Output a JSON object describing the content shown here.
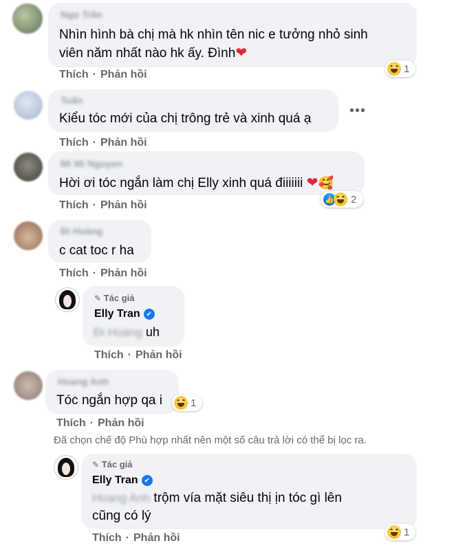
{
  "comments": [
    {
      "name": "Ngọ Trần",
      "line1": "Nhìn hình bà chị mà hk nhìn tên nic e tưởng nhỏ sinh",
      "line2": "viên năm nhất nào hk ấy. Đình",
      "reaction_count": "1"
    },
    {
      "name": "Tuấn",
      "text": "Kiểu tóc mới của chị trông trẻ và xinh quá ạ"
    },
    {
      "name": "Mi Mi Nguyen",
      "text": "Hời ơi tóc ngắn làm chị Elly xinh quá điiiiiii",
      "reaction_count": "2"
    },
    {
      "name": "Đi Hoàng",
      "text": "c cat toc r ha"
    },
    {
      "name": "Hoang Anh",
      "text": "Tóc ngắn hợp qa i",
      "reaction_count": "1"
    }
  ],
  "replies": [
    {
      "tag": "Tác giả",
      "author": "Elly Tran",
      "mention": "Đi Hoàng",
      "text": "uh"
    },
    {
      "tag": "Tác giả",
      "author": "Elly Tran",
      "mention": "Hoang Anh",
      "line1": "trộm vía mặt siêu thị ịn tóc gì lên",
      "line2": "cũng có lý",
      "reaction_count": "1"
    }
  ],
  "actions": {
    "like": "Thích",
    "reply": "Phản hồi"
  },
  "notice": "Đã chọn chế độ Phù hợp nhất nên một số câu trả lời có thể bị lọc ra.",
  "icons": {
    "verified": "verified-check-icon",
    "more": "more-options-icon",
    "author": "pencil-icon",
    "haha": "haha-reaction-icon",
    "like": "like-reaction-icon",
    "heart": "heart-emoji",
    "love_face": "smiling-face-hearts-emoji"
  },
  "colors": {
    "bubble": "#f0f2f5",
    "secondary_text": "#65676b",
    "verified": "#1877f2",
    "heart": "#e8263a"
  }
}
